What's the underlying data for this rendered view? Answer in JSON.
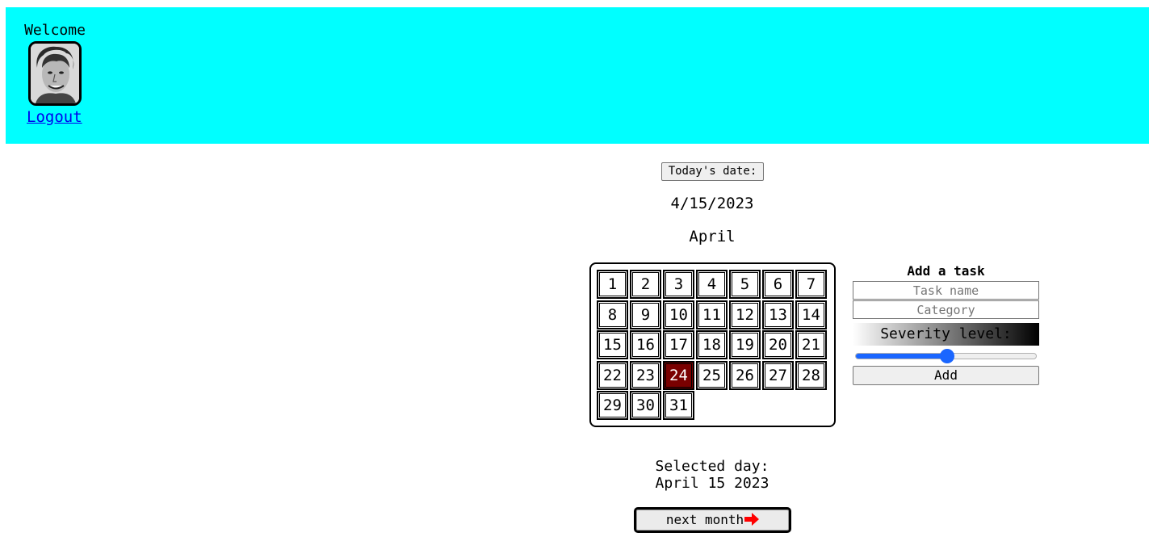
{
  "header": {
    "welcome": "Welcome",
    "logout": "Logout",
    "avatar_icon": "profile-photo"
  },
  "today": {
    "button_label": "Today's date:",
    "date": "4/15/2023"
  },
  "calendar": {
    "month": "April",
    "days": [
      "1",
      "2",
      "3",
      "4",
      "5",
      "6",
      "7",
      "8",
      "9",
      "10",
      "11",
      "12",
      "13",
      "14",
      "15",
      "16",
      "17",
      "18",
      "19",
      "20",
      "21",
      "22",
      "23",
      "24",
      "25",
      "26",
      "27",
      "28",
      "29",
      "30",
      "31"
    ],
    "highlighted_day": "24",
    "highlight_color": "#7a0000"
  },
  "task": {
    "title": "Add a task",
    "name_placeholder": "Task name",
    "category_placeholder": "Category",
    "severity_label": "Severity level:",
    "severity_value": 0.5,
    "add_label": "Add"
  },
  "selected": {
    "label": "Selected day:",
    "value": "April 15 2023"
  },
  "nav": {
    "next_label": "next month",
    "next_icon": "right-arrow-icon"
  },
  "colors": {
    "header_bg": "#00ffff",
    "slider_accent": "#1a66ff",
    "arrow": "#ff0000"
  }
}
